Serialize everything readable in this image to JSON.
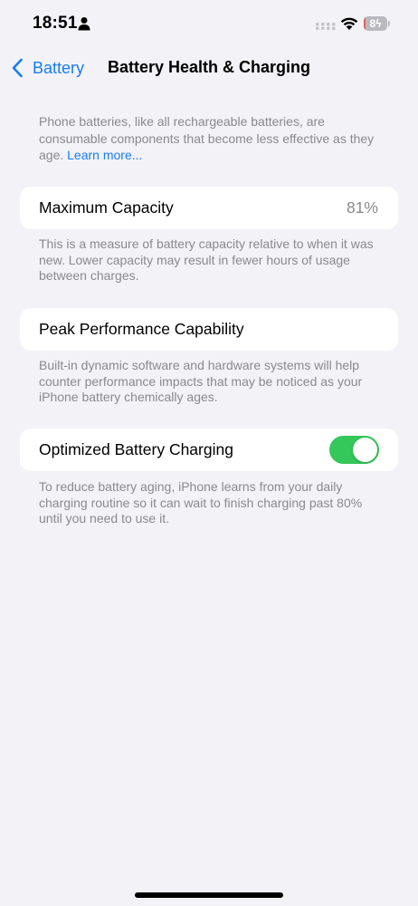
{
  "status_bar": {
    "time": "18:51",
    "battery_level": "8",
    "battery_fraction": 0.08,
    "icons": [
      "person-icon",
      "signal-icon",
      "wifi-icon",
      "battery-charging-icon"
    ]
  },
  "nav": {
    "back_label": "Battery",
    "title": "Battery Health & Charging"
  },
  "intro": {
    "text": "Phone batteries, like all rechargeable batteries, are consumable components that become less effective as they age.",
    "link": "Learn more..."
  },
  "maximum_capacity": {
    "label": "Maximum Capacity",
    "value": "81%",
    "footnote": "This is a measure of battery capacity relative to when it was new. Lower capacity may result in fewer hours of usage between charges."
  },
  "peak_performance": {
    "label": "Peak Performance Capability",
    "footnote": "Built-in dynamic software and hardware systems will help counter performance impacts that may be noticed as your iPhone battery chemically ages."
  },
  "optimized_charging": {
    "label": "Optimized Battery Charging",
    "enabled": true,
    "footnote": "To reduce battery aging, iPhone learns from your daily charging routine so it can wait to finish charging past 80% until you need to use it."
  },
  "colors": {
    "accent": "#1a7cf2",
    "toggle_on": "#34c759",
    "secondary_text": "#8a8a8e",
    "background": "#f2f2f7",
    "battery_low": "#e35f55"
  }
}
